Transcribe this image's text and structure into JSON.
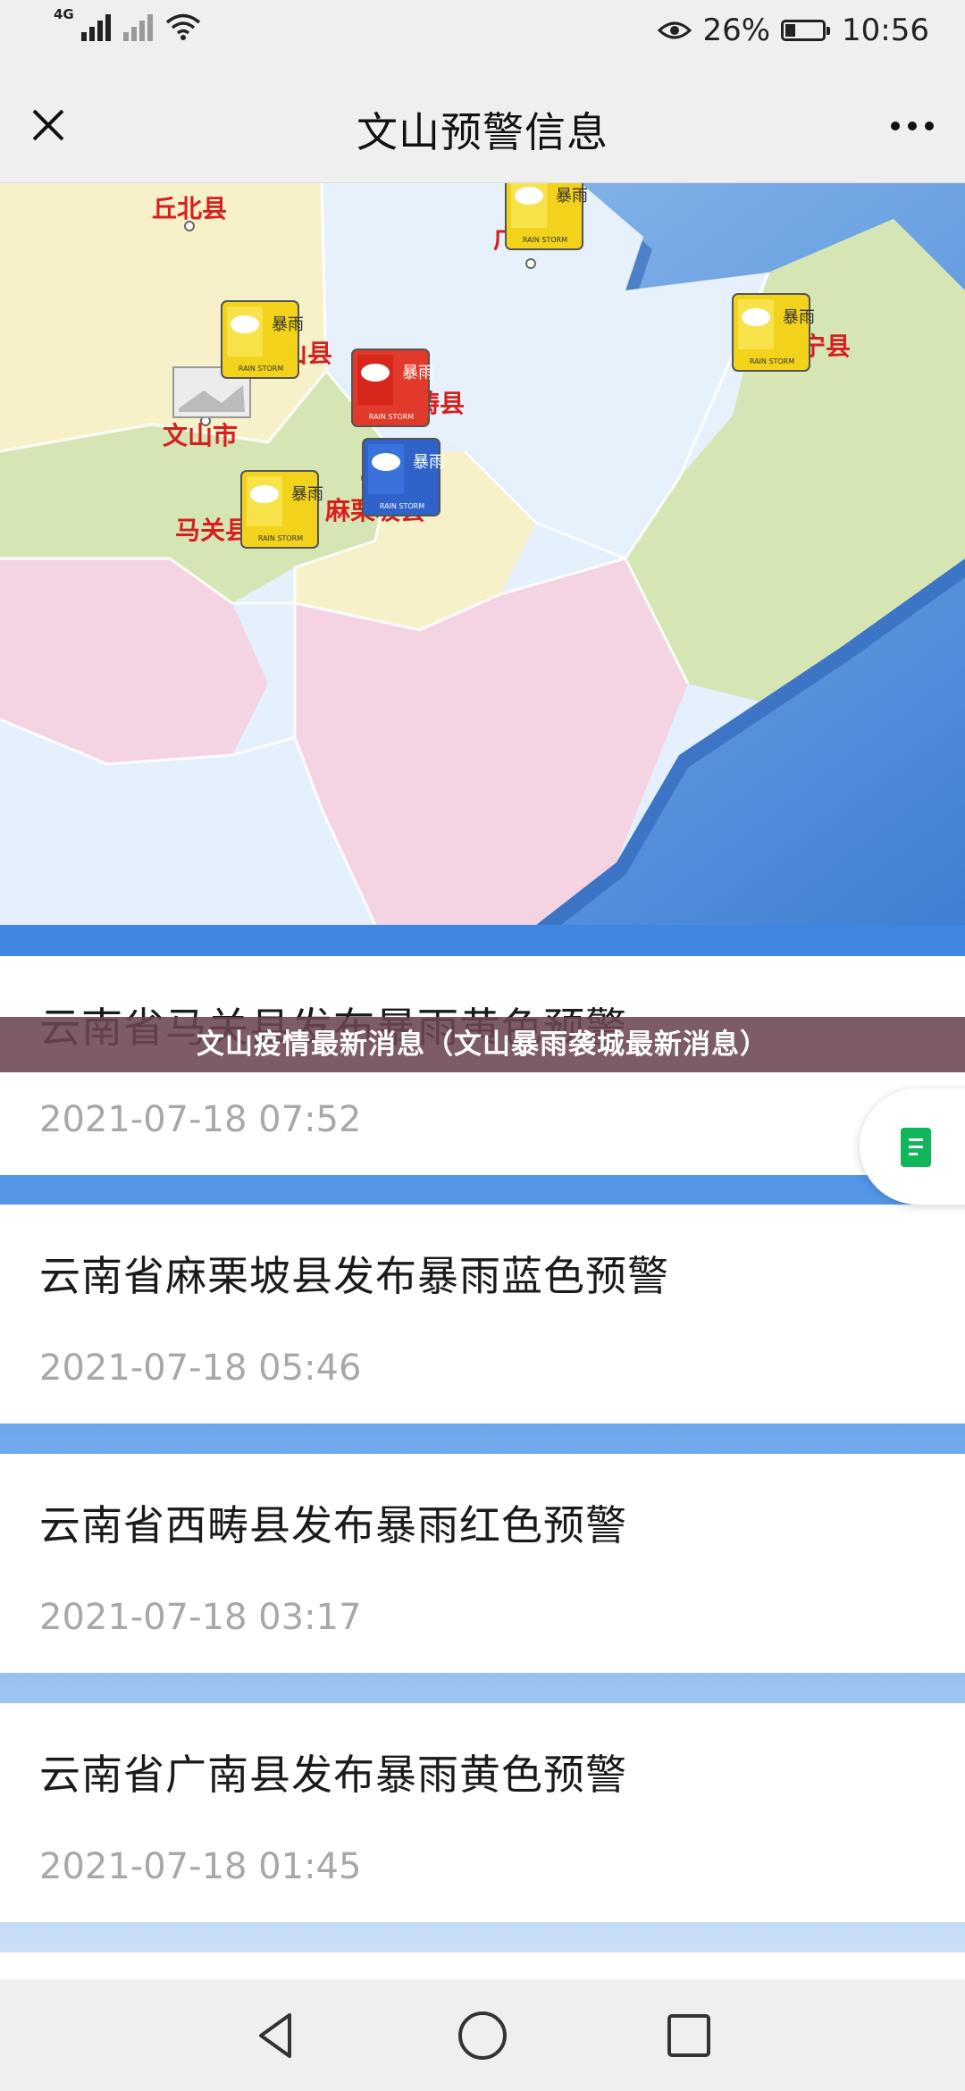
{
  "status_bar": {
    "network_tag": "4G",
    "battery_percent": "26%",
    "time": "10:56",
    "icons": [
      "signal-icon",
      "signal-weak-icon",
      "wifi-icon",
      "eye-icon",
      "battery-icon"
    ]
  },
  "header": {
    "title": "文山预警信息",
    "icons": [
      "close-icon",
      "more-icon"
    ]
  },
  "map": {
    "counties": [
      "丘北县",
      "广南县",
      "砚山县",
      "富宁县",
      "西畴县",
      "文山市",
      "麻栗坡县",
      "马关县"
    ],
    "warning_badge_text": "RAIN STORM",
    "warning_char": "暴雨",
    "colors": {
      "sea": "#6aa6e6",
      "land_yellow": "#f6f1c8",
      "land_green": "#d5e6b4",
      "land_pink": "#f4d4e2",
      "land_lightblue": "#e4f0fb",
      "label_red": "#d62020",
      "warning_yellow": "#f2d21a",
      "warning_red": "#e23a2a",
      "warning_blue": "#2f63c9"
    }
  },
  "banner": {
    "text": "文山疫情最新消息（文山暴雨袭城最新消息）"
  },
  "warnings": [
    {
      "title": "云南省马关县发布暴雨黄色预警",
      "date": "2021-07-18 07:52"
    },
    {
      "title": "云南省麻栗坡县发布暴雨蓝色预警",
      "date": "2021-07-18 05:46"
    },
    {
      "title": "云南省西畴县发布暴雨红色预警",
      "date": "2021-07-18 03:17"
    },
    {
      "title": "云南省广南县发布暴雨黄色预警",
      "date": "2021-07-18 01:45"
    }
  ],
  "float_button": {
    "icon": "document-icon",
    "color": "#11b55a"
  },
  "nav_bar": {
    "icons": [
      "back-icon",
      "home-icon",
      "recents-icon"
    ]
  }
}
